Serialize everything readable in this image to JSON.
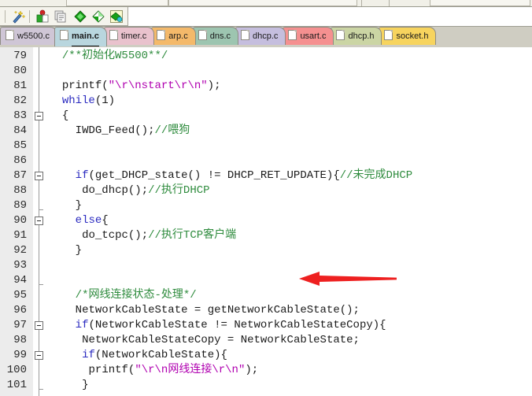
{
  "window": {
    "app": "Keil uVision code editor",
    "accent_red": "#ee2020",
    "comment_color": "#2e8b3d",
    "keyword_color": "#2b2bc0",
    "string_color": "#b000b0"
  },
  "toolbar": {
    "icons": [
      {
        "name": "magic-wand-icon",
        "label": "Magic Wand"
      },
      {
        "name": "bookmark-icon",
        "label": "Insert/Remove Bookmark"
      },
      {
        "name": "clear-bookmarks-icon",
        "label": "Clear All Bookmarks"
      },
      {
        "name": "next-bookmark-icon",
        "label": "Go To Next Bookmark"
      },
      {
        "name": "prev-bookmark-icon",
        "label": "Go To Previous Bookmark"
      },
      {
        "name": "all-bookmarks-icon",
        "label": "Bookmarks"
      }
    ]
  },
  "tabs": [
    {
      "label": "w5500.c",
      "color": "#cfc6d6",
      "active": false
    },
    {
      "label": "main.c",
      "color": "#b9d6de",
      "active": true
    },
    {
      "label": "timer.c",
      "color": "#e9c2cd",
      "active": false
    },
    {
      "label": "arp.c",
      "color": "#f4b96a",
      "active": false
    },
    {
      "label": "dns.c",
      "color": "#9dc5b0",
      "active": false
    },
    {
      "label": "dhcp.c",
      "color": "#c5bede",
      "active": false
    },
    {
      "label": "usart.c",
      "color": "#f59090",
      "active": false
    },
    {
      "label": "dhcp.h",
      "color": "#cbd5a4",
      "active": false
    },
    {
      "label": "socket.h",
      "color": "#f7d45e",
      "active": false
    }
  ],
  "editor": {
    "first_line_number": 79,
    "lines": [
      {
        "n": 79,
        "indent": 2,
        "fold": "none",
        "tokens": [
          {
            "t": "/**初始化W5500**/",
            "c": "cm"
          }
        ]
      },
      {
        "n": 80,
        "indent": 0,
        "fold": "none",
        "tokens": []
      },
      {
        "n": 81,
        "indent": 2,
        "fold": "none",
        "tokens": [
          {
            "t": "printf(",
            "c": "pl"
          },
          {
            "t": "\"\\r\\nstart\\r\\n\"",
            "c": "str"
          },
          {
            "t": ");",
            "c": "pl"
          }
        ]
      },
      {
        "n": 82,
        "indent": 2,
        "fold": "none",
        "tokens": [
          {
            "t": "while",
            "c": "kw"
          },
          {
            "t": "(1)",
            "c": "pl"
          }
        ]
      },
      {
        "n": 83,
        "indent": 2,
        "fold": "box",
        "tokens": [
          {
            "t": "{",
            "c": "pl"
          }
        ]
      },
      {
        "n": 84,
        "indent": 4,
        "fold": "bar",
        "tokens": [
          {
            "t": "IWDG_Feed();",
            "c": "pl"
          },
          {
            "t": "//喂狗",
            "c": "cm"
          }
        ]
      },
      {
        "n": 85,
        "indent": 0,
        "fold": "bar",
        "tokens": []
      },
      {
        "n": 86,
        "indent": 0,
        "fold": "bar",
        "tokens": []
      },
      {
        "n": 87,
        "indent": 4,
        "fold": "box",
        "tokens": [
          {
            "t": "if",
            "c": "kw"
          },
          {
            "t": "(get_DHCP_state() != DHCP_RET_UPDATE){",
            "c": "pl"
          },
          {
            "t": "//未完成DHCP",
            "c": "cm"
          }
        ]
      },
      {
        "n": 88,
        "indent": 5,
        "fold": "bar",
        "tokens": [
          {
            "t": "do_dhcp();",
            "c": "pl"
          },
          {
            "t": "//执行DHCP",
            "c": "cm"
          }
        ]
      },
      {
        "n": 89,
        "indent": 4,
        "fold": "tick",
        "tokens": [
          {
            "t": "}",
            "c": "pl"
          }
        ]
      },
      {
        "n": 90,
        "indent": 4,
        "fold": "box",
        "tokens": [
          {
            "t": "else",
            "c": "kw"
          },
          {
            "t": "{",
            "c": "pl"
          }
        ]
      },
      {
        "n": 91,
        "indent": 5,
        "fold": "bar",
        "tokens": [
          {
            "t": "do_tcpc();",
            "c": "pl"
          },
          {
            "t": "//执行TCP客户端",
            "c": "cm"
          }
        ]
      },
      {
        "n": 92,
        "indent": 4,
        "fold": "bar",
        "tokens": [
          {
            "t": "}",
            "c": "pl"
          }
        ]
      },
      {
        "n": 93,
        "indent": 0,
        "fold": "bar",
        "tokens": []
      },
      {
        "n": 94,
        "indent": 0,
        "fold": "tick",
        "tokens": []
      },
      {
        "n": 95,
        "indent": 4,
        "fold": "bar",
        "tokens": [
          {
            "t": "/*网线连接状态-处理*/",
            "c": "cm"
          }
        ]
      },
      {
        "n": 96,
        "indent": 4,
        "fold": "bar",
        "tokens": [
          {
            "t": "NetworkCableState = getNetworkCableState();",
            "c": "pl"
          }
        ]
      },
      {
        "n": 97,
        "indent": 4,
        "fold": "box",
        "tokens": [
          {
            "t": "if",
            "c": "kw"
          },
          {
            "t": "(NetworkCableState != NetworkCableStateCopy){",
            "c": "pl"
          }
        ]
      },
      {
        "n": 98,
        "indent": 5,
        "fold": "bar",
        "tokens": [
          {
            "t": "NetworkCableStateCopy = NetworkCableState;",
            "c": "pl"
          }
        ]
      },
      {
        "n": 99,
        "indent": 5,
        "fold": "box",
        "tokens": [
          {
            "t": "if",
            "c": "kw"
          },
          {
            "t": "(NetworkCableState){",
            "c": "pl"
          }
        ]
      },
      {
        "n": 100,
        "indent": 6,
        "fold": "bar",
        "tokens": [
          {
            "t": "printf(",
            "c": "pl"
          },
          {
            "t": "\"\\r\\n网线连接\\r\\n\"",
            "c": "str"
          },
          {
            "t": ");",
            "c": "pl"
          }
        ]
      },
      {
        "n": 101,
        "indent": 5,
        "fold": "tick",
        "tokens": [
          {
            "t": "}",
            "c": "pl"
          }
        ]
      }
    ]
  },
  "annotation": {
    "name": "red-arrow",
    "points_to_line": 91,
    "color": "#ee2020"
  }
}
